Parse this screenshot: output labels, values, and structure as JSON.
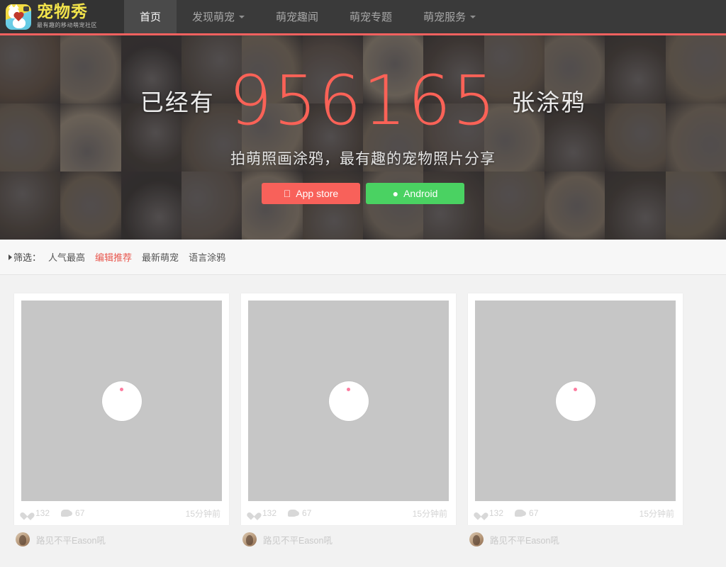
{
  "site": {
    "logo_title": "宠物秀",
    "logo_tagline": "最有趣的移动萌宠社区",
    "accent_red": "#f4615f",
    "accent_green": "#4ad262"
  },
  "nav": {
    "items": [
      {
        "label": "首页",
        "active": true,
        "has_caret": false
      },
      {
        "label": "发现萌宠",
        "active": false,
        "has_caret": true
      },
      {
        "label": "萌宠趣闻",
        "active": false,
        "has_caret": false
      },
      {
        "label": "萌宠专题",
        "active": false,
        "has_caret": false
      },
      {
        "label": "萌宠服务",
        "active": false,
        "has_caret": true
      }
    ]
  },
  "hero": {
    "prefix": "已经有",
    "count": "956165",
    "suffix": "张涂鸦",
    "subtitle": "拍萌照画涂鸦，最有趣的宠物照片分享",
    "ios_button": {
      "label": "App store",
      "icon": "apple-icon",
      "glyph": ""
    },
    "android_button": {
      "label": "Android",
      "icon": "android-icon",
      "glyph": "🤖"
    }
  },
  "filter": {
    "label": "筛选：",
    "options": [
      {
        "label": "人气最高",
        "active": false
      },
      {
        "label": "编辑推荐",
        "active": true
      },
      {
        "label": "最新萌宠",
        "active": false
      },
      {
        "label": "语言涂鸦",
        "active": false
      }
    ]
  },
  "cards": [
    {
      "likes": "132",
      "comments": "67",
      "time": "15分钟前",
      "author": "路见不平Eason吼",
      "image_state": "loading"
    },
    {
      "likes": "132",
      "comments": "67",
      "time": "15分钟前",
      "author": "路见不平Eason吼",
      "image_state": "loading"
    },
    {
      "likes": "132",
      "comments": "67",
      "time": "15分钟前",
      "author": "路见不平Eason吼",
      "image_state": "loading"
    }
  ],
  "mosaic_colors": [
    "#6d5a4a",
    "#9a8b78",
    "#3f3a38",
    "#5e544b",
    "#8f7f6b",
    "#6a5c52",
    "#a89a86",
    "#564b43",
    "#7b6a58",
    "#948674",
    "#4e453e",
    "#8a7a66",
    "#7e6f5e",
    "#b0a08a",
    "#4a423c",
    "#6f6254",
    "#a1917c",
    "#5c5047",
    "#8b7c69",
    "#6e6157",
    "#9b8c78",
    "#4f463f",
    "#7a6b5a",
    "#8d7e6c",
    "#5a4f45",
    "#867663",
    "#3d3835",
    "#72655a",
    "#a4947f",
    "#635648",
    "#8f8170",
    "#574d45",
    "#7d6e5d",
    "#998975",
    "#4c443d",
    "#857660"
  ]
}
